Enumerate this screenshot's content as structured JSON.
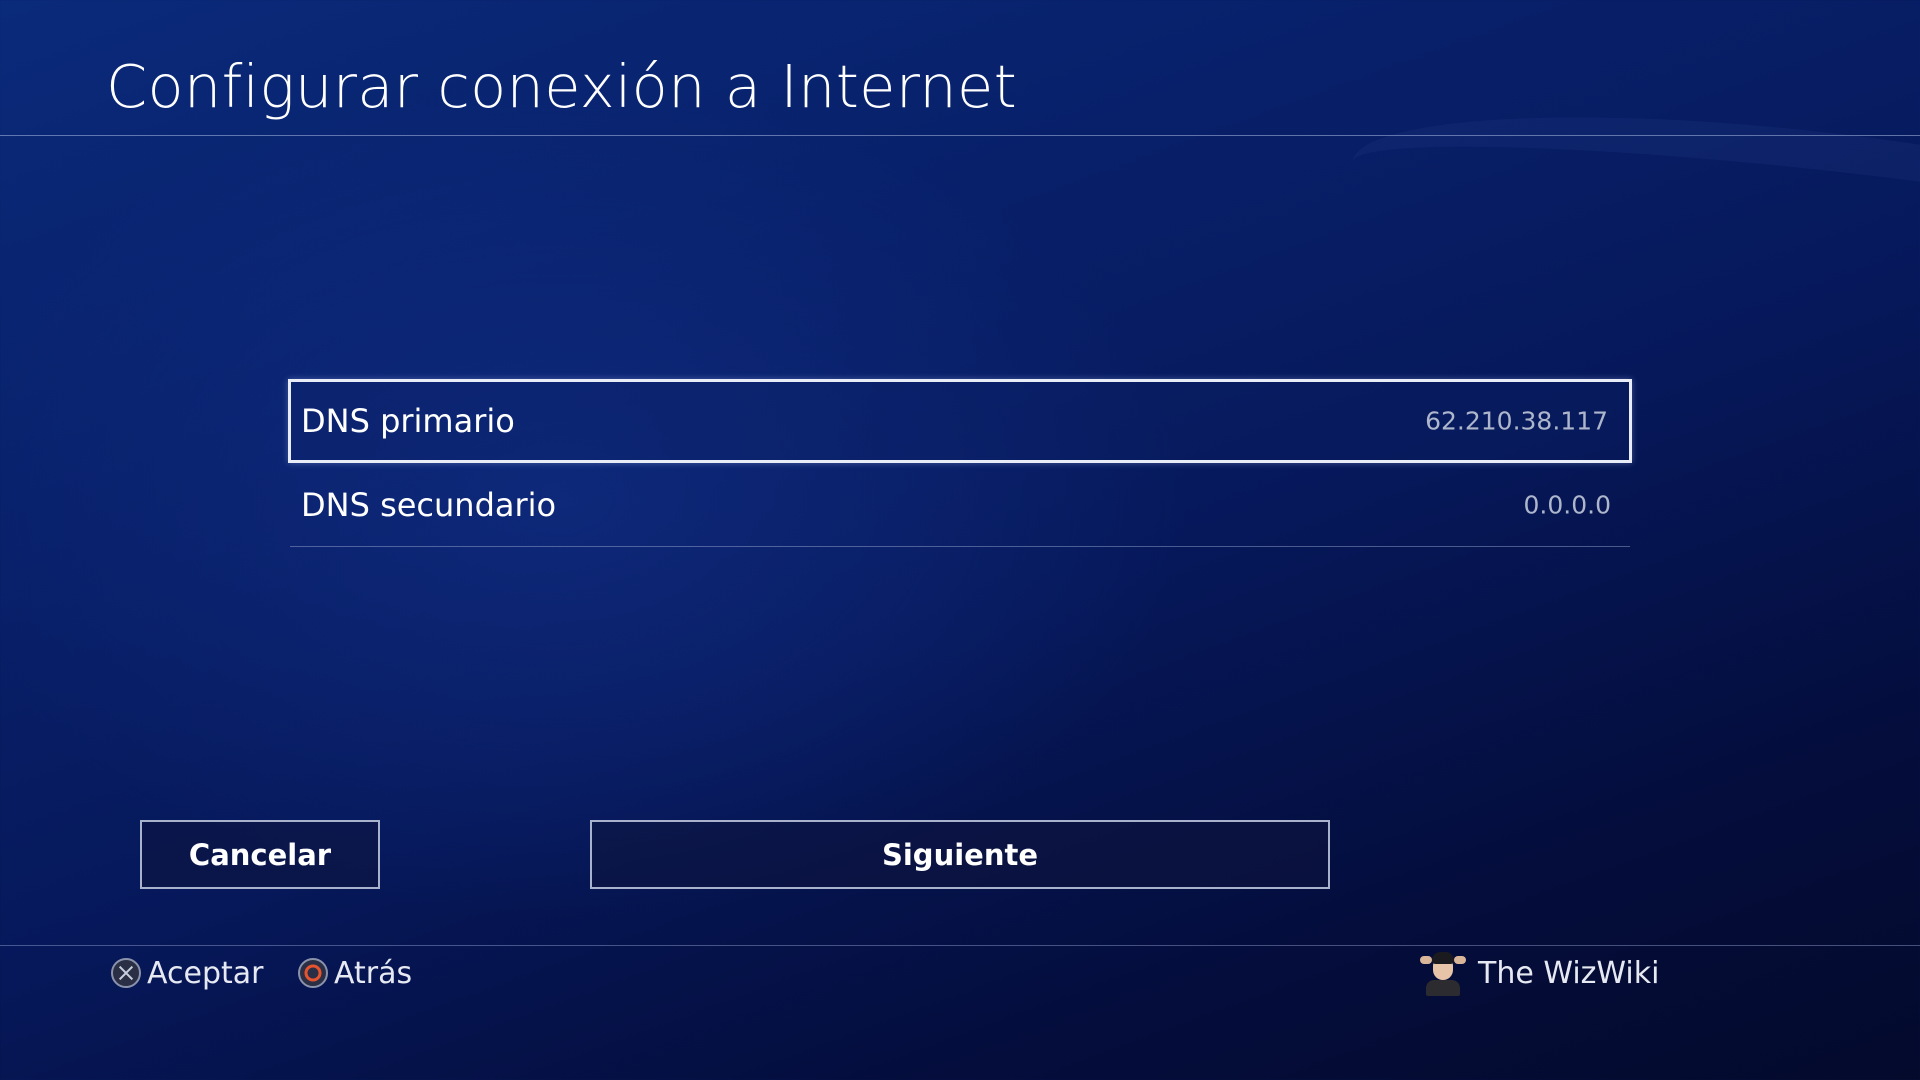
{
  "header": {
    "title": "Configurar conexión a Internet"
  },
  "dns": {
    "primary": {
      "label": "DNS primario",
      "value": "62.210.38.117"
    },
    "secondary": {
      "label": "DNS secundario",
      "value": "0.0.0.0"
    }
  },
  "buttons": {
    "cancel_label": "Cancelar",
    "next_label": "Siguiente"
  },
  "footer": {
    "accept_label": "Aceptar",
    "accept_icon": "cross-button-icon",
    "back_label": "Atrás",
    "back_icon": "circle-button-icon",
    "user_name": "The WizWiki"
  },
  "colors": {
    "background": "#06185a",
    "circle_button": "#e5532f",
    "selection_border": "#e8ecf6"
  }
}
